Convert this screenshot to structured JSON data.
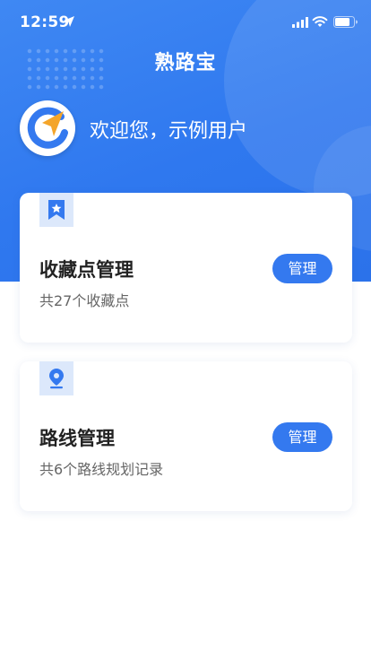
{
  "status_bar": {
    "time": "12:59"
  },
  "header": {
    "app_title": "熟路宝",
    "welcome_text": "欢迎您，示例用户"
  },
  "cards": [
    {
      "title": "收藏点管理",
      "subtitle": "共27个收藏点",
      "button_label": "管理",
      "icon": "bookmark-star-icon"
    },
    {
      "title": "路线管理",
      "subtitle": "共6个路线规划记录",
      "button_label": "管理",
      "icon": "location-pin-icon"
    }
  ],
  "colors": {
    "primary": "#3479ef",
    "accent": "#f4a52a",
    "badge_bg": "#dce8fb"
  }
}
